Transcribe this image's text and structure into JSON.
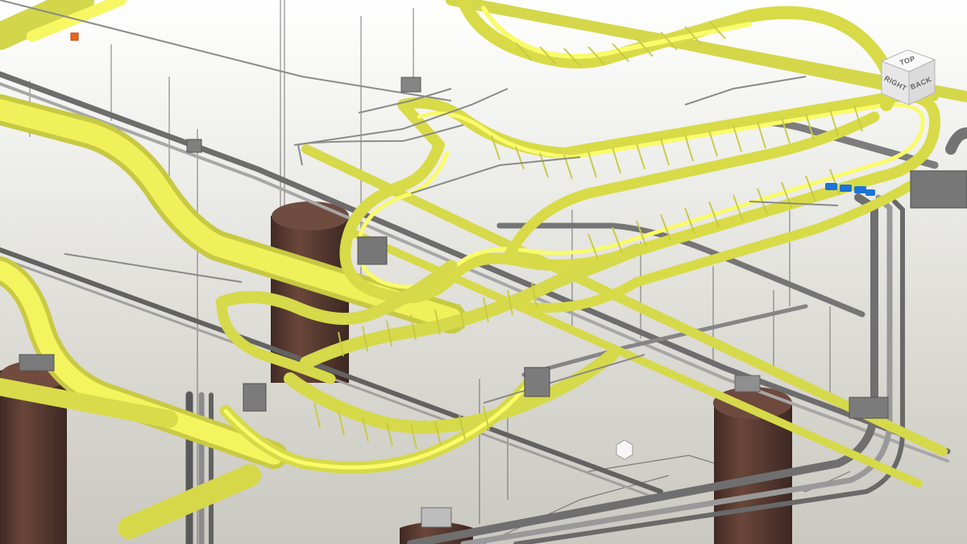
{
  "viewcube": {
    "top_label": "TOP",
    "right_label": "RIGHT",
    "back_label": "BACK"
  },
  "colors": {
    "background": "#d9d8d2",
    "cable_tray": "#d7d949",
    "cable_tray_highlight": "#f2f35f",
    "conduit": "#8f8f8f",
    "column": "#58382d",
    "junction_box": "#777777",
    "fitting": "#1c74d9",
    "selected_marker": "#e86a1b"
  },
  "icons": {
    "navigation": "viewcube-icon",
    "fitting": "blue-coupling-icon",
    "marker": "selection-marker-icon"
  }
}
